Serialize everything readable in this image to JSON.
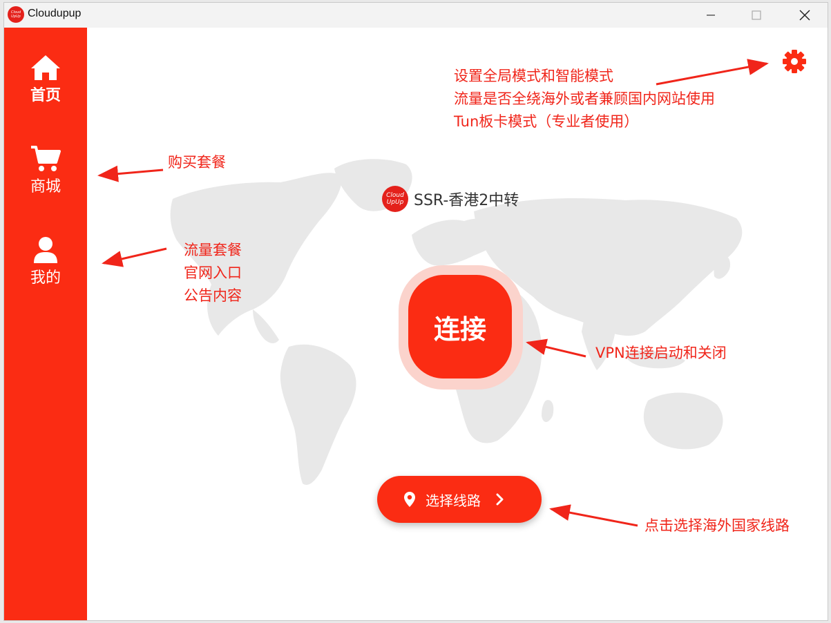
{
  "window": {
    "title": "Cloudupup",
    "logo_text": [
      "Cloud",
      "UpUp"
    ],
    "controls": {
      "minimize": "—",
      "maximize": "☐",
      "close": "✕"
    }
  },
  "sidebar": {
    "items": [
      {
        "label": "首页",
        "icon": "home-icon",
        "active": true
      },
      {
        "label": "商城",
        "icon": "cart-icon",
        "active": false
      },
      {
        "label": "我的",
        "icon": "user-icon",
        "active": false
      }
    ]
  },
  "main": {
    "server": {
      "logo_text": [
        "Cloud",
        "UpUp"
      ],
      "name": "SSR-香港2中转"
    },
    "connect_label": "连接",
    "route_button": {
      "label": "选择线路",
      "icon": "location-pin-icon",
      "chevron": "chevron-right-icon"
    },
    "settings_icon": "gear-icon"
  },
  "annotations": {
    "settings": [
      "设置全局模式和智能模式",
      "流量是否全绕海外或者兼顾国内网站使用",
      "Tun板卡模式（专业者使用）"
    ],
    "shop": "购买套餐",
    "mine": [
      "流量套餐",
      "官网入口",
      "公告内容"
    ],
    "connect": "VPN连接启动和关闭",
    "route": "点击选择海外国家线路"
  },
  "colors": {
    "accent": "#fb2c13",
    "accent_light": "#fbd3cc",
    "annotation": "#f0251a",
    "map": "#e8e8e8",
    "titlebar": "#f3f3f3"
  }
}
